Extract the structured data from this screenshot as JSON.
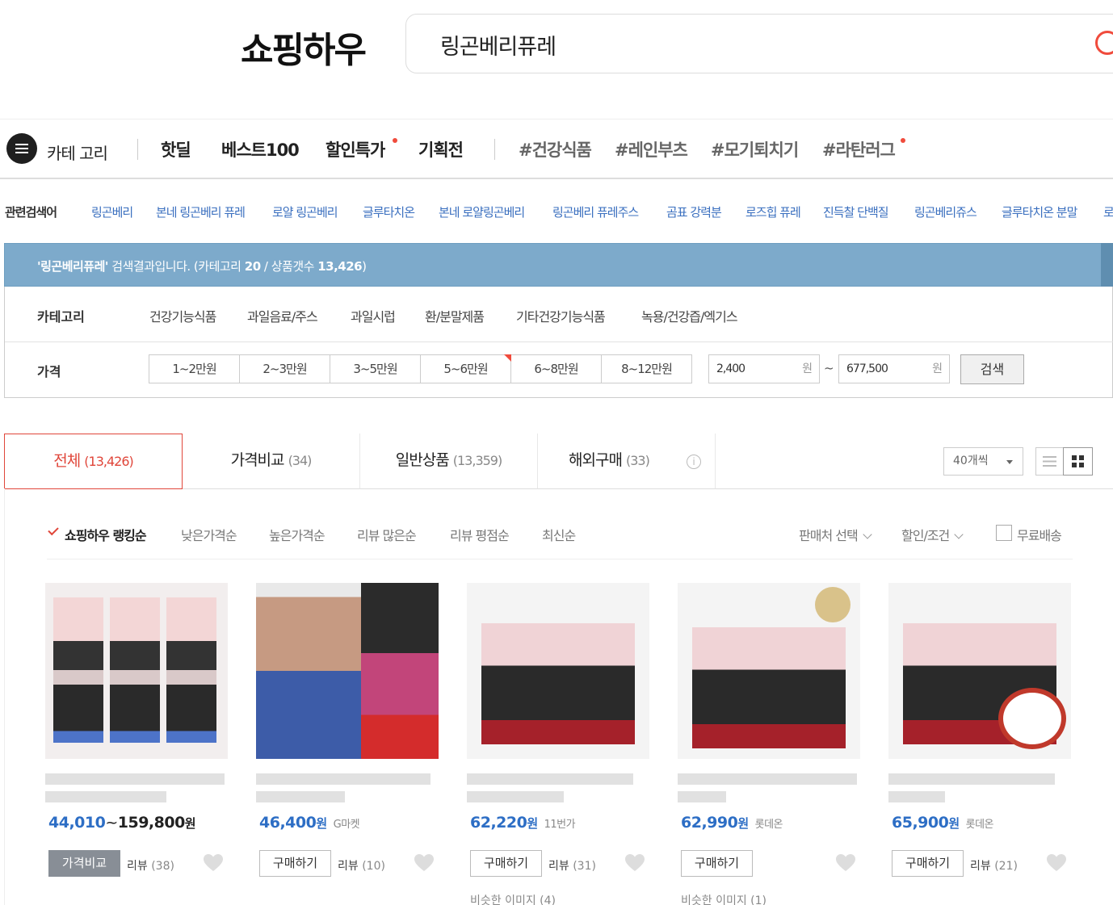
{
  "header": {
    "logo": "쇼핑하우",
    "search_query": "링곤베리퓨레"
  },
  "nav": {
    "category_label": "카테 고리",
    "items": [
      "핫딜",
      "베스트100",
      "할인특가",
      "기획전"
    ],
    "tags": [
      "#건강식품",
      "#레인부츠",
      "#모기퇴치기",
      "#라탄러그"
    ]
  },
  "related": {
    "label": "관련검색어",
    "keywords": [
      "링곤베리",
      "본네 링곤베리 퓨레",
      "로얄 링곤베리",
      "글루타치온",
      "본네 로얄링곤베리",
      "링곤베리 퓨레주스",
      "곰표 강력분",
      "로즈힙 퓨레",
      "진득찰 단백질",
      "링곤베리쥬스",
      "글루타치온 분말",
      "로"
    ]
  },
  "banner": {
    "query": "'링곤베리퓨레'",
    "suffix": "검색결과입니다. (카테고리",
    "category_count": "20",
    "product_label": "/ 상품갯수",
    "product_count": "13,426",
    "close": ")"
  },
  "filters": {
    "category_label": "카테고리",
    "categories": [
      "건강기능식품",
      "과일음료/주스",
      "과일시럽",
      "환/분말제품",
      "기타건강기능식품",
      "녹용/건강즙/엑기스"
    ],
    "price_label": "가격",
    "price_ranges": [
      "1~2만원",
      "2~3만원",
      "3~5만원",
      "5~6만원",
      "6~8만원",
      "8~12만원"
    ],
    "price_min": "2,400",
    "price_max": "677,500",
    "price_unit": "원",
    "tilde": "~",
    "search_button": "검색"
  },
  "tabs": [
    {
      "label": "전체",
      "count": "(13,426)"
    },
    {
      "label": "가격비교",
      "count": "(34)"
    },
    {
      "label": "일반상품",
      "count": "(13,359)"
    },
    {
      "label": "해외구매",
      "count": "(33)"
    }
  ],
  "info_icon_glyph": "i",
  "per_page": "40개씩",
  "sort": {
    "active": "쇼핑하우 랭킹순",
    "options": [
      "낮은가격순",
      "높은가격순",
      "리뷰 많은순",
      "리뷰 평점순",
      "최신순"
    ],
    "seller_filter": "판매처 선택",
    "discount_filter": "할인/조건",
    "free_shipping": "무료배송"
  },
  "products": [
    {
      "price": "44,010",
      "won": "원",
      "tilde": "~",
      "max_price": "159,800",
      "shop": "",
      "button": "가격비교",
      "review_label": "리뷰",
      "review_count": "(38)",
      "similar": ""
    },
    {
      "price": "46,400",
      "won": "원",
      "shop": "G마켓",
      "button": "구매하기",
      "review_label": "리뷰",
      "review_count": "(10)",
      "similar": ""
    },
    {
      "price": "62,220",
      "won": "원",
      "shop": "11번가",
      "button": "구매하기",
      "review_label": "리뷰",
      "review_count": "(31)",
      "similar": "비슷한 이미지 (4)"
    },
    {
      "price": "62,990",
      "won": "원",
      "shop": "롯데온",
      "button": "구매하기",
      "review_label": "",
      "review_count": "",
      "similar": "비슷한 이미지 (1)"
    },
    {
      "price": "65,900",
      "won": "원",
      "shop": "롯데온",
      "button": "구매하기",
      "review_label": "리뷰",
      "review_count": "(21)",
      "similar": ""
    }
  ],
  "colors": {
    "accent_red": "#e0463a",
    "price_blue": "#2d6ec5",
    "banner_blue": "#7daacb",
    "link_blue": "#3a6fbf"
  }
}
